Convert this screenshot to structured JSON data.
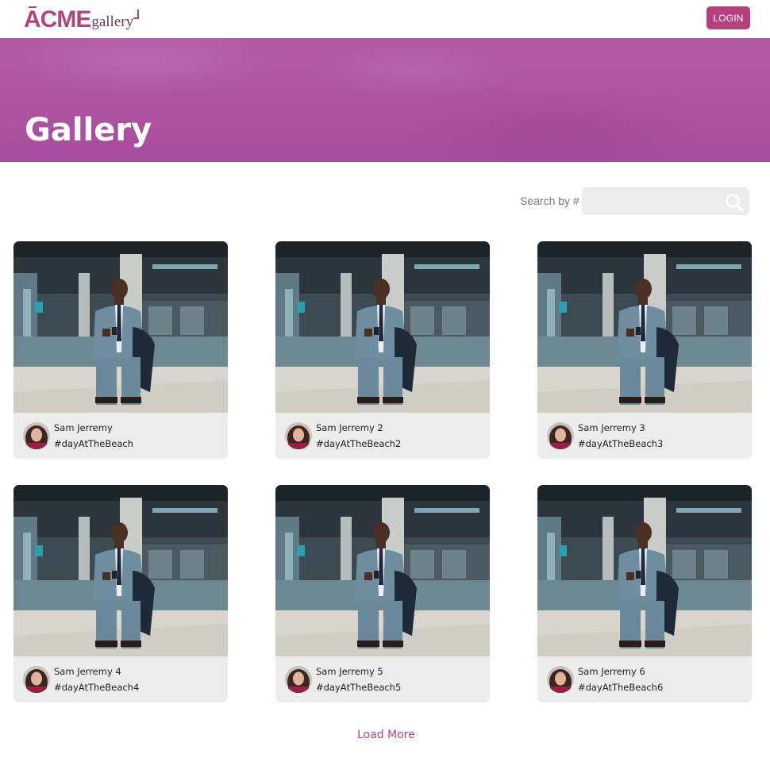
{
  "header": {
    "logo_primary": "ACME",
    "logo_secondary": "gallery",
    "login_label": "LOGIN"
  },
  "hero": {
    "title": "Gallery"
  },
  "search": {
    "label": "Search by #",
    "value": "",
    "placeholder": "",
    "icon": "search-icon"
  },
  "cards": [
    {
      "name": "Sam Jerremy",
      "tag": "#dayAtTheBeach"
    },
    {
      "name": "Sam Jerremy 2",
      "tag": "#dayAtTheBeach2"
    },
    {
      "name": "Sam Jerremy 3",
      "tag": "#dayAtTheBeach3"
    },
    {
      "name": "Sam Jerremy 4",
      "tag": "#dayAtTheBeach4"
    },
    {
      "name": "Sam Jerremy 5",
      "tag": "#dayAtTheBeach5"
    },
    {
      "name": "Sam Jerremy 6",
      "tag": "#dayAtTheBeach6"
    }
  ],
  "load_more_label": "Load More",
  "colors": {
    "brand": "#b5407e",
    "hero": "#ad53a2",
    "card_footer": "#ececec"
  }
}
